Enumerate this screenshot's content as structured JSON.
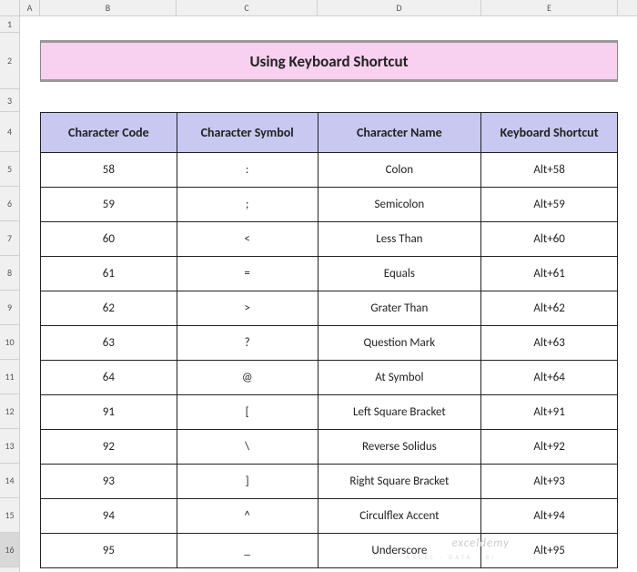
{
  "columns": [
    "A",
    "B",
    "C",
    "D",
    "E"
  ],
  "row_numbers": [
    1,
    2,
    3,
    4,
    5,
    6,
    7,
    8,
    9,
    10,
    11,
    12,
    13,
    14,
    15,
    16
  ],
  "selected_row": 16,
  "title": "Using Keyboard Shortcut",
  "headers": {
    "code": "Character Code",
    "symbol": "Character Symbol",
    "name": "Character Name",
    "shortcut": "Keyboard Shortcut"
  },
  "rows": [
    {
      "code": "58",
      "symbol": ":",
      "name": "Colon",
      "shortcut": "Alt+58"
    },
    {
      "code": "59",
      "symbol": ";",
      "name": "Semicolon",
      "shortcut": "Alt+59"
    },
    {
      "code": "60",
      "symbol": "<",
      "name": "Less Than",
      "shortcut": "Alt+60"
    },
    {
      "code": "61",
      "symbol": "=",
      "name": "Equals",
      "shortcut": "Alt+61"
    },
    {
      "code": "62",
      "symbol": ">",
      "name": "Grater Than",
      "shortcut": "Alt+62"
    },
    {
      "code": "63",
      "symbol": "?",
      "name": "Question Mark",
      "shortcut": "Alt+63"
    },
    {
      "code": "64",
      "symbol": "@",
      "name": "At Symbol",
      "shortcut": "Alt+64"
    },
    {
      "code": "91",
      "symbol": "[",
      "name": "Left Square Bracket",
      "shortcut": "Alt+91"
    },
    {
      "code": "92",
      "symbol": "\\",
      "name": "Reverse Solidus",
      "shortcut": "Alt+92"
    },
    {
      "code": "93",
      "symbol": "]",
      "name": "Right Square Bracket",
      "shortcut": "Alt+93"
    },
    {
      "code": "94",
      "symbol": "^",
      "name": "Circulflex Accent",
      "shortcut": "Alt+94"
    },
    {
      "code": "95",
      "symbol": "_",
      "name": "Underscore",
      "shortcut": "Alt+95"
    }
  ],
  "watermark": "exceldemy",
  "watermark_sub": "EXCEL · DATA · BI",
  "chart_data": {
    "type": "table",
    "title": "Using Keyboard Shortcut",
    "columns": [
      "Character Code",
      "Character Symbol",
      "Character Name",
      "Keyboard Shortcut"
    ],
    "rows": [
      [
        58,
        ":",
        "Colon",
        "Alt+58"
      ],
      [
        59,
        ";",
        "Semicolon",
        "Alt+59"
      ],
      [
        60,
        "<",
        "Less Than",
        "Alt+60"
      ],
      [
        61,
        "=",
        "Equals",
        "Alt+61"
      ],
      [
        62,
        ">",
        "Grater Than",
        "Alt+62"
      ],
      [
        63,
        "?",
        "Question Mark",
        "Alt+63"
      ],
      [
        64,
        "@",
        "At Symbol",
        "Alt+64"
      ],
      [
        91,
        "[",
        "Left Square Bracket",
        "Alt+91"
      ],
      [
        92,
        "\\",
        "Reverse Solidus",
        "Alt+92"
      ],
      [
        93,
        "]",
        "Right Square Bracket",
        "Alt+93"
      ],
      [
        94,
        "^",
        "Circulflex Accent",
        "Alt+94"
      ],
      [
        95,
        "_",
        "Underscore",
        "Alt+95"
      ]
    ]
  }
}
